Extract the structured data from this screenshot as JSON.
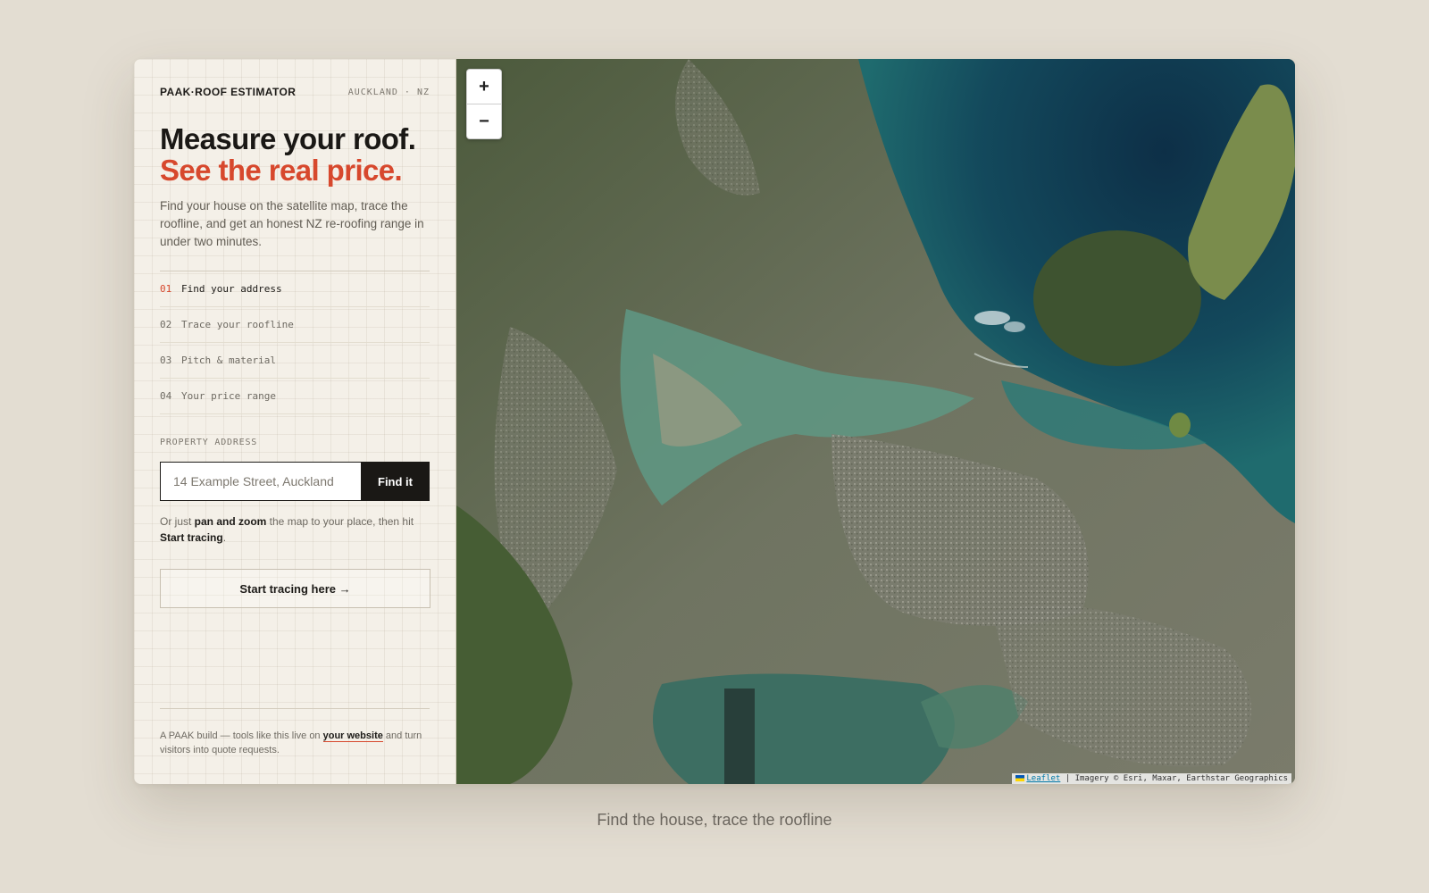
{
  "header": {
    "brand": "PAAK·ROOF ESTIMATOR",
    "locale": "AUCKLAND · NZ"
  },
  "hero": {
    "title_line1": "Measure your roof.",
    "title_line2": "See the real price.",
    "intro": "Find your house on the satellite map, trace the roofline, and get an honest NZ re-roofing range in under two minutes."
  },
  "steps": [
    {
      "num": "01",
      "label": "Find your address",
      "active": true
    },
    {
      "num": "02",
      "label": "Trace your roofline",
      "active": false
    },
    {
      "num": "03",
      "label": "Pitch & material",
      "active": false
    },
    {
      "num": "04",
      "label": "Your price range",
      "active": false
    }
  ],
  "address": {
    "section_label": "PROPERTY ADDRESS",
    "placeholder": "14 Example Street, Auckland",
    "button": "Find it"
  },
  "hint": {
    "prefix": "Or just ",
    "bold1": "pan and zoom",
    "middle": " the map to your place, then hit ",
    "bold2": "Start tracing",
    "suffix": "."
  },
  "trace_button": "Start tracing here →",
  "footer": {
    "prefix": "A PAAK build — tools like this live on ",
    "link": "your website",
    "suffix": " and turn visitors into quote requests."
  },
  "map": {
    "zoom_in": "+",
    "zoom_out": "−",
    "attribution_link": "Leaflet",
    "attribution_text": " | Imagery © Esri, Maxar, Earthstar Geographics"
  },
  "caption": "Find the house, trace the roofline",
  "colors": {
    "accent": "#d7482d",
    "ink": "#1a1815",
    "background": "#e3ddd2",
    "panel": "#f4f0e8"
  }
}
